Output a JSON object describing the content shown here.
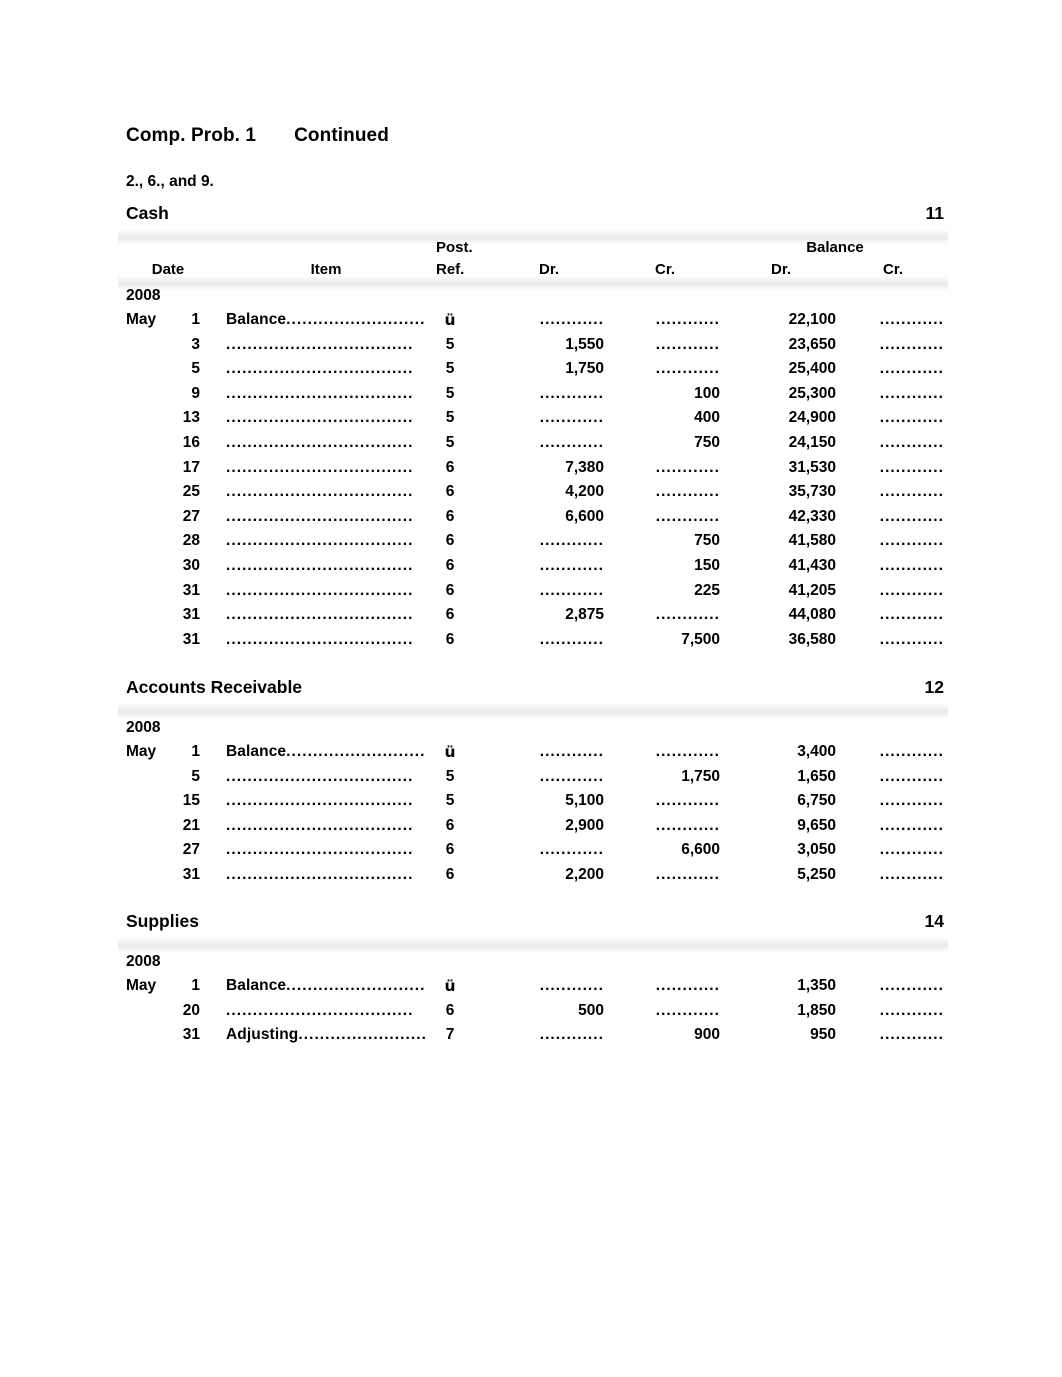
{
  "document": {
    "title_main": "Comp. Prob. 1",
    "title_continued": "Continued",
    "subtitle": "2., 6., and 9.",
    "dotted_leader": "............",
    "item_leader_dots": "...................................",
    "check_mark": "ü"
  },
  "columns": {
    "date": "Date",
    "item": "Item",
    "post": "Post.",
    "ref": "Ref.",
    "dr": "Dr.",
    "cr": "Cr.",
    "balance": "Balance",
    "balance_dr": "Dr.",
    "balance_cr": "Cr."
  },
  "accounts": [
    {
      "name": "Cash",
      "number": "11",
      "year": "2008",
      "show_column_header": true,
      "rows": [
        {
          "month": "May",
          "day": "1",
          "item": "Balance",
          "ref": "ü",
          "dr": "",
          "cr": "",
          "bal_dr": "22,100",
          "bal_cr": ""
        },
        {
          "month": "",
          "day": "3",
          "item": "",
          "ref": "5",
          "dr": "1,550",
          "cr": "",
          "bal_dr": "23,650",
          "bal_cr": ""
        },
        {
          "month": "",
          "day": "5",
          "item": "",
          "ref": "5",
          "dr": "1,750",
          "cr": "",
          "bal_dr": "25,400",
          "bal_cr": ""
        },
        {
          "month": "",
          "day": "9",
          "item": "",
          "ref": "5",
          "dr": "",
          "cr": "100",
          "bal_dr": "25,300",
          "bal_cr": ""
        },
        {
          "month": "",
          "day": "13",
          "item": "",
          "ref": "5",
          "dr": "",
          "cr": "400",
          "bal_dr": "24,900",
          "bal_cr": ""
        },
        {
          "month": "",
          "day": "16",
          "item": "",
          "ref": "5",
          "dr": "",
          "cr": "750",
          "bal_dr": "24,150",
          "bal_cr": ""
        },
        {
          "month": "",
          "day": "17",
          "item": "",
          "ref": "6",
          "dr": "7,380",
          "cr": "",
          "bal_dr": "31,530",
          "bal_cr": ""
        },
        {
          "month": "",
          "day": "25",
          "item": "",
          "ref": "6",
          "dr": "4,200",
          "cr": "",
          "bal_dr": "35,730",
          "bal_cr": ""
        },
        {
          "month": "",
          "day": "27",
          "item": "",
          "ref": "6",
          "dr": "6,600",
          "cr": "",
          "bal_dr": "42,330",
          "bal_cr": ""
        },
        {
          "month": "",
          "day": "28",
          "item": "",
          "ref": "6",
          "dr": "",
          "cr": "750",
          "bal_dr": "41,580",
          "bal_cr": ""
        },
        {
          "month": "",
          "day": "30",
          "item": "",
          "ref": "6",
          "dr": "",
          "cr": "150",
          "bal_dr": "41,430",
          "bal_cr": ""
        },
        {
          "month": "",
          "day": "31",
          "item": "",
          "ref": "6",
          "dr": "",
          "cr": "225",
          "bal_dr": "41,205",
          "bal_cr": ""
        },
        {
          "month": "",
          "day": "31",
          "item": "",
          "ref": "6",
          "dr": "2,875",
          "cr": "",
          "bal_dr": "44,080",
          "bal_cr": ""
        },
        {
          "month": "",
          "day": "31",
          "item": "",
          "ref": "6",
          "dr": "",
          "cr": "7,500",
          "bal_dr": "36,580",
          "bal_cr": ""
        }
      ]
    },
    {
      "name": "Accounts Receivable",
      "number": "12",
      "year": "2008",
      "show_column_header": false,
      "rows": [
        {
          "month": "May",
          "day": "1",
          "item": "Balance",
          "ref": "ü",
          "dr": "",
          "cr": "",
          "bal_dr": "3,400",
          "bal_cr": ""
        },
        {
          "month": "",
          "day": "5",
          "item": "",
          "ref": "5",
          "dr": "",
          "cr": "1,750",
          "bal_dr": "1,650",
          "bal_cr": ""
        },
        {
          "month": "",
          "day": "15",
          "item": "",
          "ref": "5",
          "dr": "5,100",
          "cr": "",
          "bal_dr": "6,750",
          "bal_cr": ""
        },
        {
          "month": "",
          "day": "21",
          "item": "",
          "ref": "6",
          "dr": "2,900",
          "cr": "",
          "bal_dr": "9,650",
          "bal_cr": ""
        },
        {
          "month": "",
          "day": "27",
          "item": "",
          "ref": "6",
          "dr": "",
          "cr": "6,600",
          "bal_dr": "3,050",
          "bal_cr": ""
        },
        {
          "month": "",
          "day": "31",
          "item": "",
          "ref": "6",
          "dr": "2,200",
          "cr": "",
          "bal_dr": "5,250",
          "bal_cr": ""
        }
      ]
    },
    {
      "name": "Supplies",
      "number": "14",
      "year": "2008",
      "show_column_header": false,
      "rows": [
        {
          "month": "May",
          "day": "1",
          "item": "Balance",
          "ref": "ü",
          "dr": "",
          "cr": "",
          "bal_dr": "1,350",
          "bal_cr": ""
        },
        {
          "month": "",
          "day": "20",
          "item": "",
          "ref": "6",
          "dr": "500",
          "cr": "",
          "bal_dr": "1,850",
          "bal_cr": ""
        },
        {
          "month": "",
          "day": "31",
          "item": "Adjusting",
          "ref": "7",
          "dr": "",
          "cr": "900",
          "bal_dr": "950",
          "bal_cr": ""
        }
      ]
    }
  ],
  "layout": {
    "account_tops": [
      203,
      677,
      911
    ],
    "row_height": 24.6
  }
}
